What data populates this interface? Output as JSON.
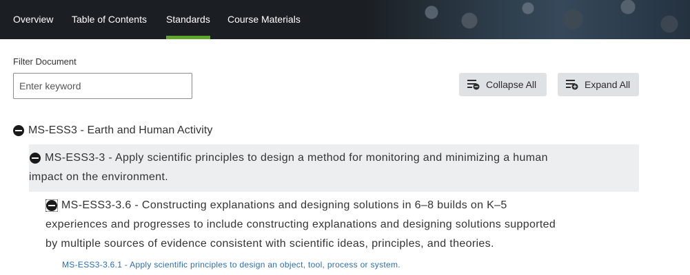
{
  "nav": {
    "tabs": [
      {
        "label": "Overview"
      },
      {
        "label": "Table of Contents"
      },
      {
        "label": "Standards",
        "active": true
      },
      {
        "label": "Course Materials"
      }
    ],
    "active_underline_color": "#5ea52a"
  },
  "filter": {
    "label": "Filter Document",
    "placeholder": "Enter keyword",
    "value": ""
  },
  "actions": {
    "collapse_label": "Collapse All",
    "collapse_icon": "list-collapse-icon",
    "expand_label": "Expand All",
    "expand_icon": "list-expand-icon"
  },
  "tree": {
    "level1": {
      "icon": "minus-circle-icon",
      "label": "MS-ESS3 - Earth and Human Activity"
    },
    "level2": {
      "icon": "minus-circle-icon",
      "line1": "MS-ESS3-3 - Apply scientific principles to design a method for monitoring and minimizing a human",
      "line2": "impact on the environment."
    },
    "level3": {
      "icon": "minus-circle-icon",
      "line1": "MS-ESS3-3.6 - Constructing explanations and designing solutions in 6–8 builds on K–5",
      "line2": "experiences and progresses to include constructing explanations and designing solutions supported",
      "line3": "by multiple sources of evidence consistent with scientific ideas, principles, and theories."
    },
    "level4": {
      "link": "MS-ESS3-3.6.1 - Apply scientific principles to design an object, tool, process or system."
    }
  }
}
